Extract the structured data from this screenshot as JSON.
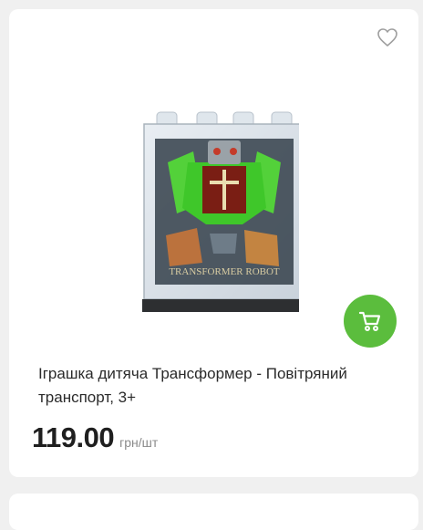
{
  "product": {
    "title": "Іграшка дитяча Трансформер - Повітряний транспорт, 3+",
    "price": "119.00",
    "unit": "грн/шт",
    "package_text": "TRANSFORMER ROBOT",
    "image_icon": "toy-transformer-box-image",
    "favorite_icon": "heart-outline-icon",
    "cart_icon": "shopping-cart-icon"
  },
  "colors": {
    "accent": "#5bbd3d",
    "card_bg": "#ffffff",
    "page_bg": "#f0f0f0"
  }
}
